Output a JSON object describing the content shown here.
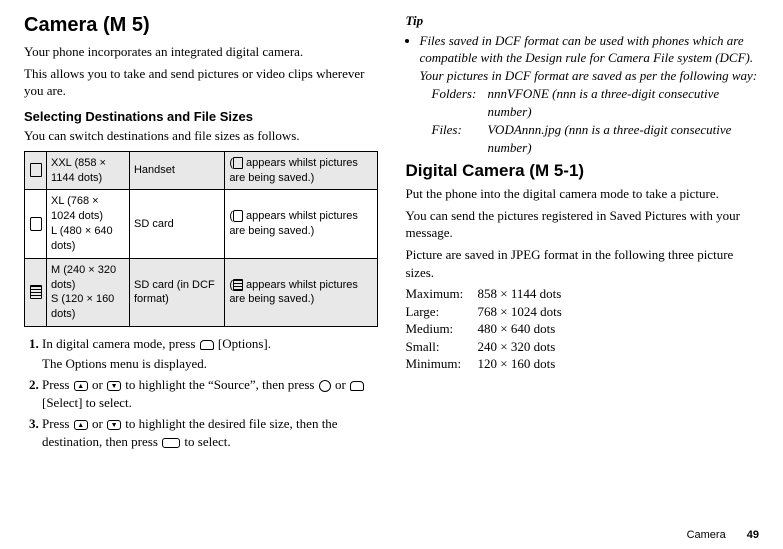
{
  "left": {
    "h1": "Camera",
    "h1_menu": "(M 5)",
    "p1": "Your phone incorporates an integrated digital camera.",
    "p2": "This allows you to take and send pictures or video clips wherever you are.",
    "h3": "Selecting Destinations and File Sizes",
    "p3": "You can switch destinations and file sizes as follows.",
    "table": {
      "rows": [
        {
          "sizes": "XXL (858 × 1144 dots)",
          "dest": "Handset",
          "note_pre": "(",
          "note_post": " appears whilst pictures are being saved.)",
          "icon": "card-icon"
        },
        {
          "sizes": "XL (768 × 1024 dots)\nL (480 × 640 dots)",
          "dest": "SD card",
          "note_pre": "(",
          "note_post": " appears whilst pictures are being saved.)",
          "icon": "sd-icon"
        },
        {
          "sizes": "M (240 × 320 dots)\nS (120 × 160 dots)",
          "dest": "SD card (in DCF format)",
          "note_pre": "(",
          "note_post": " appears whilst pictures are being saved.)",
          "icon": "film-icon"
        }
      ]
    },
    "steps": [
      {
        "pre": "In digital camera mode, press ",
        "post": " [Options].",
        "sub": "The Options menu is displayed."
      },
      {
        "t1": "Press ",
        "t2": " or ",
        "t3": " to highlight the “Source”, then press ",
        "t4": " or ",
        "t5": " [Select] to select."
      },
      {
        "t1": "Press ",
        "t2": " or ",
        "t3": " to highlight the desired file size, then the destination, then press ",
        "t4": " to select."
      }
    ]
  },
  "right": {
    "tip_head": "Tip",
    "tip_body": "Files saved in DCF format can be used with phones which are compatible with the Design rule for Camera File system (DCF). Your pictures in DCF format are saved as per the following way:",
    "folders_k": "Folders:",
    "folders_v": "nnnVFONE (nnn is a three-digit consecutive number)",
    "files_k": "Files:",
    "files_v": "VODAnnn.jpg (nnn is a three-digit consecutive number)",
    "h2": "Digital Camera",
    "h2_menu": "(M 5-1)",
    "p1": "Put the phone into the digital camera mode to take a picture.",
    "p2": "You can send the pictures registered in Saved Pictures with your message.",
    "p3": "Picture are saved in JPEG format in the following three picture sizes.",
    "sizes": [
      {
        "k": "Maximum:",
        "v": "858 × 1144 dots"
      },
      {
        "k": "Large:",
        "v": "768 × 1024 dots"
      },
      {
        "k": "Medium:",
        "v": "480 × 640 dots"
      },
      {
        "k": "Small:",
        "v": "240 × 320 dots"
      },
      {
        "k": "Minimum:",
        "v": "120 × 160 dots"
      }
    ]
  },
  "footer": {
    "label": "Camera",
    "page": "49"
  }
}
